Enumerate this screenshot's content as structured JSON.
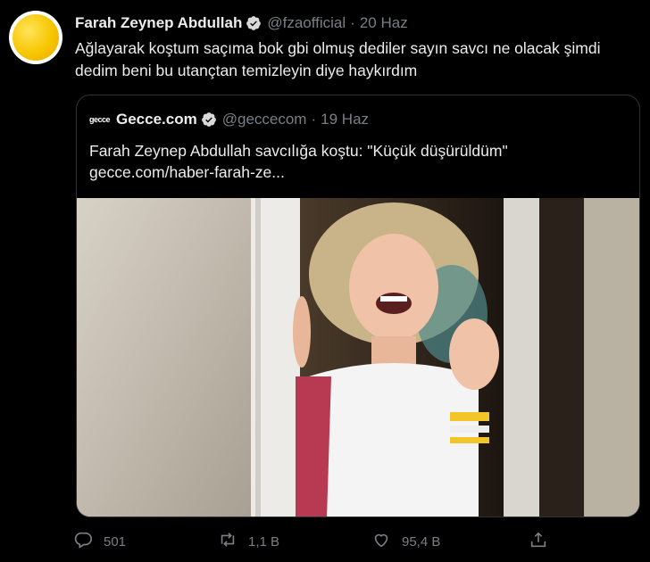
{
  "tweet": {
    "author_name": "Farah Zeynep Abdullah",
    "handle": "@fzaofficial",
    "separator": "·",
    "date": "20 Haz",
    "text": "Ağlayarak koştum saçıma bok gbi olmuş dediler sayın savcı ne olacak şimdi dedim beni bu utançtan temizleyin diye haykırdım"
  },
  "quote": {
    "logo_text": "gecce",
    "author_name": "Gecce.com",
    "handle": "@geccecom",
    "separator": "·",
    "date": "19 Haz",
    "headline": "Farah Zeynep Abdullah savcılığa koştu: \"Küçük düşürüldüm\"",
    "link": "gecce.com/haber-farah-ze..."
  },
  "actions": {
    "reply_count": "501",
    "retweet_count": "1,1 B",
    "like_count": "95,4 B"
  },
  "colors": {
    "background": "#000000",
    "secondary_text": "#7a7f84",
    "border": "#2f3336",
    "verified_badge": "#d9d9d9"
  },
  "icons": [
    "verified-icon",
    "reply-icon",
    "retweet-icon",
    "like-icon",
    "share-icon"
  ]
}
